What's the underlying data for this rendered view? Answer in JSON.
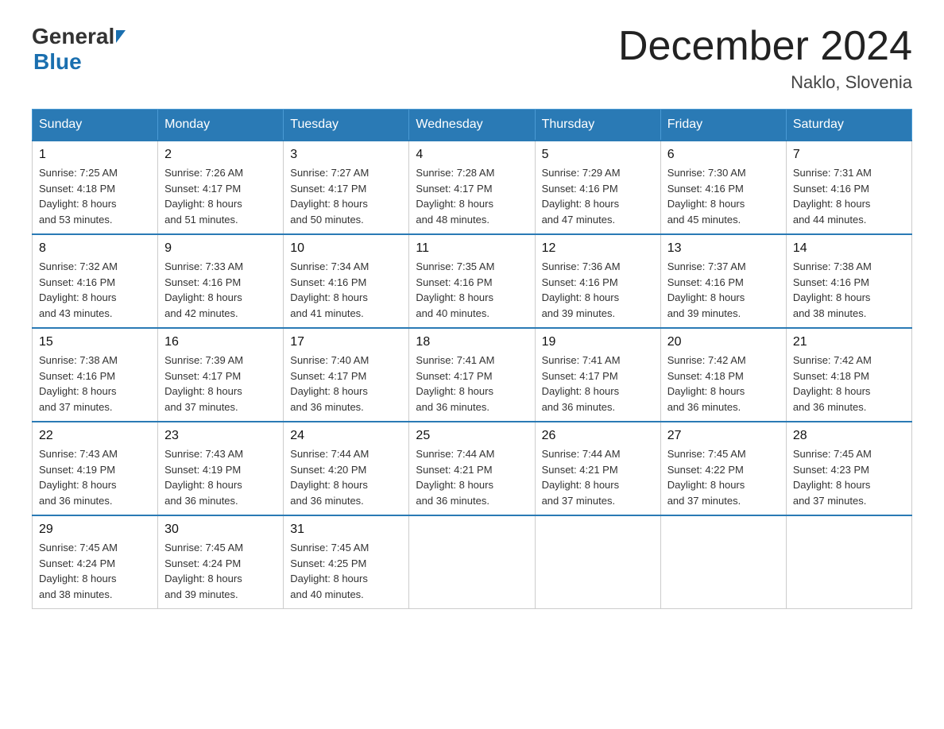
{
  "header": {
    "logo_general": "General",
    "logo_blue": "Blue",
    "title": "December 2024",
    "location": "Naklo, Slovenia"
  },
  "days_of_week": [
    "Sunday",
    "Monday",
    "Tuesday",
    "Wednesday",
    "Thursday",
    "Friday",
    "Saturday"
  ],
  "weeks": [
    [
      {
        "day": "1",
        "sunrise": "7:25 AM",
        "sunset": "4:18 PM",
        "daylight": "8 hours and 53 minutes."
      },
      {
        "day": "2",
        "sunrise": "7:26 AM",
        "sunset": "4:17 PM",
        "daylight": "8 hours and 51 minutes."
      },
      {
        "day": "3",
        "sunrise": "7:27 AM",
        "sunset": "4:17 PM",
        "daylight": "8 hours and 50 minutes."
      },
      {
        "day": "4",
        "sunrise": "7:28 AM",
        "sunset": "4:17 PM",
        "daylight": "8 hours and 48 minutes."
      },
      {
        "day": "5",
        "sunrise": "7:29 AM",
        "sunset": "4:16 PM",
        "daylight": "8 hours and 47 minutes."
      },
      {
        "day": "6",
        "sunrise": "7:30 AM",
        "sunset": "4:16 PM",
        "daylight": "8 hours and 45 minutes."
      },
      {
        "day": "7",
        "sunrise": "7:31 AM",
        "sunset": "4:16 PM",
        "daylight": "8 hours and 44 minutes."
      }
    ],
    [
      {
        "day": "8",
        "sunrise": "7:32 AM",
        "sunset": "4:16 PM",
        "daylight": "8 hours and 43 minutes."
      },
      {
        "day": "9",
        "sunrise": "7:33 AM",
        "sunset": "4:16 PM",
        "daylight": "8 hours and 42 minutes."
      },
      {
        "day": "10",
        "sunrise": "7:34 AM",
        "sunset": "4:16 PM",
        "daylight": "8 hours and 41 minutes."
      },
      {
        "day": "11",
        "sunrise": "7:35 AM",
        "sunset": "4:16 PM",
        "daylight": "8 hours and 40 minutes."
      },
      {
        "day": "12",
        "sunrise": "7:36 AM",
        "sunset": "4:16 PM",
        "daylight": "8 hours and 39 minutes."
      },
      {
        "day": "13",
        "sunrise": "7:37 AM",
        "sunset": "4:16 PM",
        "daylight": "8 hours and 39 minutes."
      },
      {
        "day": "14",
        "sunrise": "7:38 AM",
        "sunset": "4:16 PM",
        "daylight": "8 hours and 38 minutes."
      }
    ],
    [
      {
        "day": "15",
        "sunrise": "7:38 AM",
        "sunset": "4:16 PM",
        "daylight": "8 hours and 37 minutes."
      },
      {
        "day": "16",
        "sunrise": "7:39 AM",
        "sunset": "4:17 PM",
        "daylight": "8 hours and 37 minutes."
      },
      {
        "day": "17",
        "sunrise": "7:40 AM",
        "sunset": "4:17 PM",
        "daylight": "8 hours and 36 minutes."
      },
      {
        "day": "18",
        "sunrise": "7:41 AM",
        "sunset": "4:17 PM",
        "daylight": "8 hours and 36 minutes."
      },
      {
        "day": "19",
        "sunrise": "7:41 AM",
        "sunset": "4:17 PM",
        "daylight": "8 hours and 36 minutes."
      },
      {
        "day": "20",
        "sunrise": "7:42 AM",
        "sunset": "4:18 PM",
        "daylight": "8 hours and 36 minutes."
      },
      {
        "day": "21",
        "sunrise": "7:42 AM",
        "sunset": "4:18 PM",
        "daylight": "8 hours and 36 minutes."
      }
    ],
    [
      {
        "day": "22",
        "sunrise": "7:43 AM",
        "sunset": "4:19 PM",
        "daylight": "8 hours and 36 minutes."
      },
      {
        "day": "23",
        "sunrise": "7:43 AM",
        "sunset": "4:19 PM",
        "daylight": "8 hours and 36 minutes."
      },
      {
        "day": "24",
        "sunrise": "7:44 AM",
        "sunset": "4:20 PM",
        "daylight": "8 hours and 36 minutes."
      },
      {
        "day": "25",
        "sunrise": "7:44 AM",
        "sunset": "4:21 PM",
        "daylight": "8 hours and 36 minutes."
      },
      {
        "day": "26",
        "sunrise": "7:44 AM",
        "sunset": "4:21 PM",
        "daylight": "8 hours and 37 minutes."
      },
      {
        "day": "27",
        "sunrise": "7:45 AM",
        "sunset": "4:22 PM",
        "daylight": "8 hours and 37 minutes."
      },
      {
        "day": "28",
        "sunrise": "7:45 AM",
        "sunset": "4:23 PM",
        "daylight": "8 hours and 37 minutes."
      }
    ],
    [
      {
        "day": "29",
        "sunrise": "7:45 AM",
        "sunset": "4:24 PM",
        "daylight": "8 hours and 38 minutes."
      },
      {
        "day": "30",
        "sunrise": "7:45 AM",
        "sunset": "4:24 PM",
        "daylight": "8 hours and 39 minutes."
      },
      {
        "day": "31",
        "sunrise": "7:45 AM",
        "sunset": "4:25 PM",
        "daylight": "8 hours and 40 minutes."
      },
      null,
      null,
      null,
      null
    ]
  ],
  "labels": {
    "sunrise": "Sunrise:",
    "sunset": "Sunset:",
    "daylight": "Daylight:"
  }
}
